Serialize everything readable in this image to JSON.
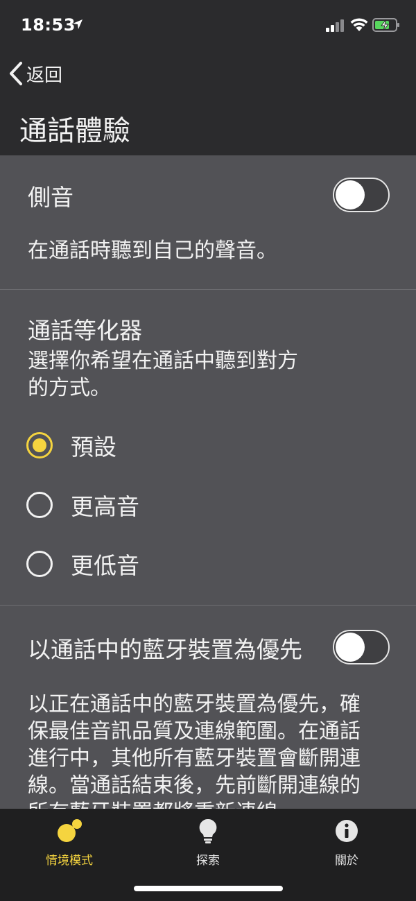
{
  "status": {
    "time": "18:53"
  },
  "nav": {
    "back_label": "返回",
    "title": "通話體驗"
  },
  "sidetone": {
    "label": "側音",
    "enabled": false,
    "description": "在通話時聽到自己的聲音。"
  },
  "equalizer": {
    "title": "通話等化器",
    "description_lines": [
      "選擇你希望在通話中聽到對方",
      "的方式。"
    ],
    "options": [
      {
        "label": "預設",
        "selected": true
      },
      {
        "label": "更高音",
        "selected": false
      },
      {
        "label": "更低音",
        "selected": false
      }
    ]
  },
  "bluetooth_priority": {
    "label": "以通話中的藍牙裝置為優先",
    "enabled": false,
    "description_lines": [
      "以正在通話中的藍牙裝置為優先，確",
      "保最佳音訊品質及連線範圍。在通話",
      "進行中，其他所有藍牙裝置會斷開連",
      "線。當通話結束後，先前斷開連線的",
      "所有藍牙裝置都將重新連線。"
    ]
  },
  "tabs": [
    {
      "label": "情境模式",
      "icon": "modes-icon",
      "active": true
    },
    {
      "label": "探索",
      "icon": "lightbulb-icon",
      "active": false
    },
    {
      "label": "關於",
      "icon": "info-icon",
      "active": false
    }
  ],
  "colors": {
    "accent": "#f5d43f",
    "background": "#525256",
    "bar": "#2b2b2d"
  }
}
